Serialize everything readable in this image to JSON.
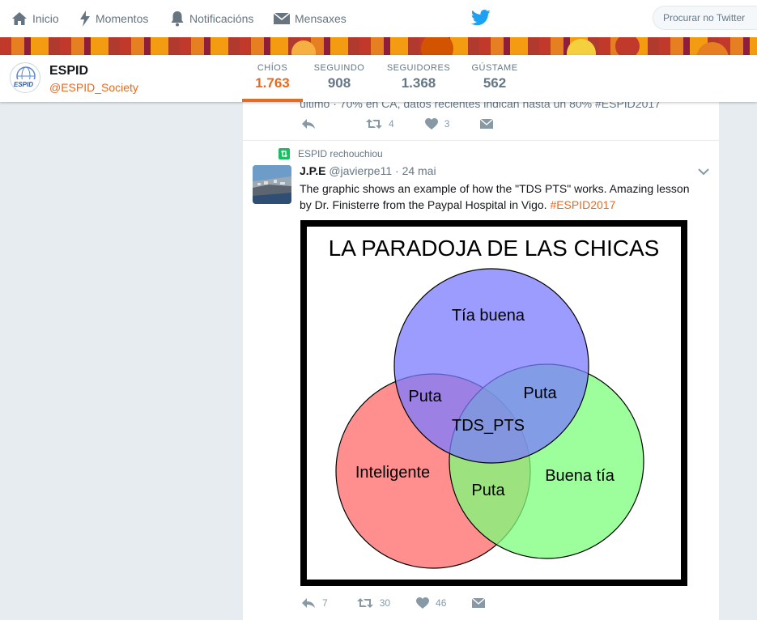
{
  "nav": {
    "items": [
      {
        "label": "Inicio",
        "icon": "home-icon"
      },
      {
        "label": "Momentos",
        "icon": "lightning-icon"
      },
      {
        "label": "Notificacións",
        "icon": "bell-icon"
      },
      {
        "label": "Mensaxes",
        "icon": "envelope-icon"
      }
    ],
    "search_placeholder": "Procurar no Twitter"
  },
  "profile": {
    "name": "ESPID",
    "handle": "@ESPID_Society",
    "avatar_text": "ESPID"
  },
  "stats": [
    {
      "label": "CHÍOS",
      "value": "1.763",
      "active": true
    },
    {
      "label": "SEGUINDO",
      "value": "908"
    },
    {
      "label": "SEGUIDORES",
      "value": "1.368"
    },
    {
      "label": "GÚSTAME",
      "value": "562"
    }
  ],
  "prev_tweet": {
    "text_partial": "último · 70% en CA, datos recientes indican hasta un 80% #ESPID2017",
    "replies": "",
    "retweets": "4",
    "likes": "3"
  },
  "tweet": {
    "retweet_context": "ESPID rechouchiou",
    "author_name": "J.P.E",
    "author_handle": "@javierpe11",
    "separator": "·",
    "date": "24 mai",
    "text": "The graphic shows an example of how the \"TDS PTS\" works. Amazing lesson by Dr. Finisterre from the Paypal Hospital in Vigo. ",
    "hashtag": "#ESPID2017",
    "replies": "7",
    "retweets": "30",
    "likes": "46"
  },
  "venn": {
    "title": "LA PARADOJA DE LAS CHICAS",
    "top": "Tía buena",
    "left": "Inteligente",
    "right": "Buena tía",
    "top_left": "Puta",
    "top_right": "Puta",
    "bottom": "Puta",
    "center": "TDS_PTS",
    "colors": {
      "top": "#7b7bff",
      "left": "#ff7b7b",
      "right": "#7bff7b"
    }
  },
  "colors": {
    "accent": "#e66a1f",
    "twitter_blue": "#1da1f2"
  }
}
